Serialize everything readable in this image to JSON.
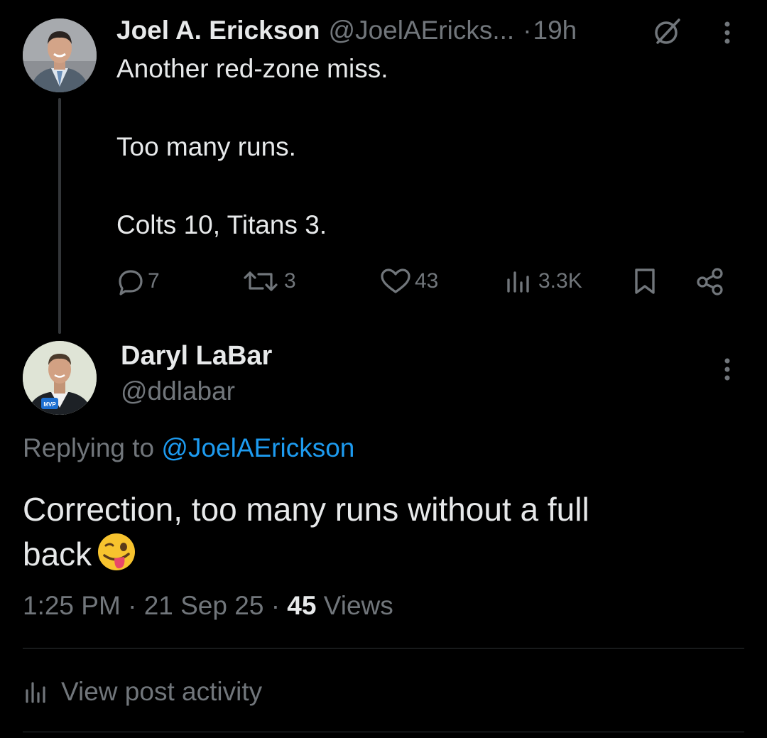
{
  "parent_tweet": {
    "author_name": "Joel A. Erickson",
    "author_handle": "@JoelAEricks...",
    "separator": "·",
    "time_ago": "19h",
    "lines": [
      "Another red-zone miss.",
      "Too many runs.",
      "Colts 10, Titans 3."
    ],
    "actions": {
      "replies": "7",
      "reposts": "3",
      "likes": "43",
      "views": "3.3K"
    },
    "icons": [
      "avatar",
      "grok-icon",
      "more-vertical-icon",
      "reply-icon",
      "repost-icon",
      "like-icon",
      "views-icon",
      "bookmark-icon",
      "share-icon"
    ]
  },
  "main_tweet": {
    "author_name": "Daryl LaBar",
    "author_handle": "@ddlabar",
    "replying_prefix": "Replying to",
    "replying_mention": "@JoelAErickson",
    "body_line_1": "Correction, too many runs without a full",
    "body_line_2": "back",
    "emoji": "winking-face-with-tongue",
    "time": "1:25 PM",
    "sep1": "·",
    "date": "21 Sep 25",
    "sep2": "·",
    "views_count": "45",
    "views_label": "Views",
    "avatar_badge": "MVP"
  },
  "post_activity": {
    "label": "View post activity"
  },
  "colors": {
    "background": "#000000",
    "text": "#e7e9ea",
    "muted": "#71767b",
    "link": "#1d9bf0",
    "divider": "#2f3336",
    "thread_line": "#333639"
  }
}
